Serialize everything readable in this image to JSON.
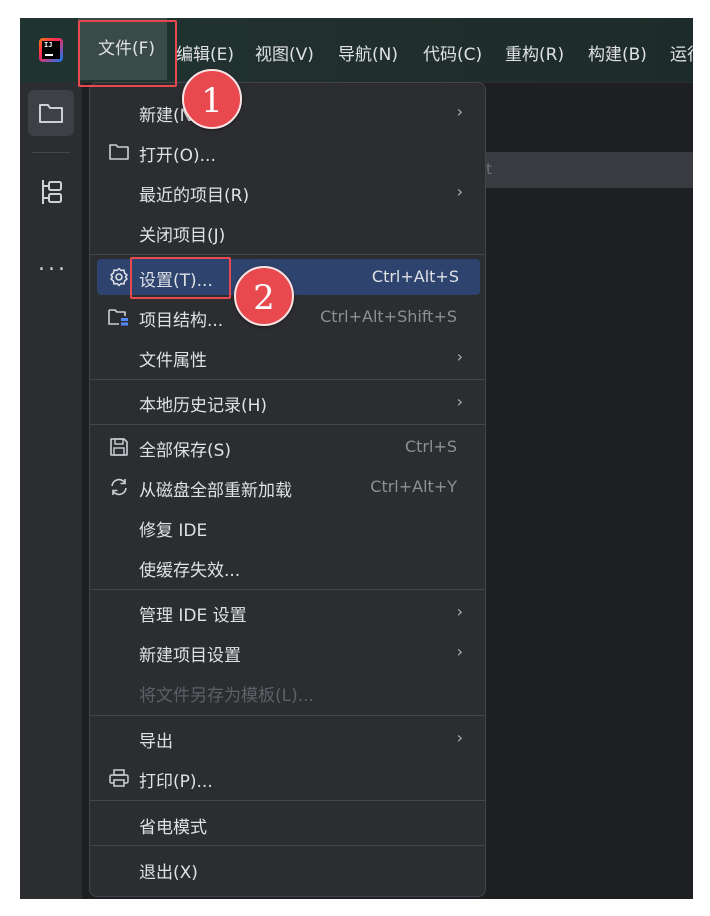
{
  "menubar": {
    "items": [
      {
        "label": "文件(F)"
      },
      {
        "label": "编辑(E)"
      },
      {
        "label": "视图(V)"
      },
      {
        "label": "导航(N)"
      },
      {
        "label": "代码(C)"
      },
      {
        "label": "重构(R)"
      },
      {
        "label": "构建(B)"
      },
      {
        "label": "运行"
      }
    ]
  },
  "logo": {
    "text": "IJ"
  },
  "sidebar": {
    "items": [
      {
        "icon": "folder-icon"
      },
      {
        "icon": "structure-icon"
      },
      {
        "icon": "more-icon",
        "label": "..."
      }
    ]
  },
  "editor": {
    "hint_fragment": "t"
  },
  "file_menu": {
    "items": [
      {
        "label": "新建(N)",
        "submenu": true
      },
      {
        "label": "打开(O)...",
        "icon": "folder-icon"
      },
      {
        "label": "最近的项目(R)",
        "submenu": true
      },
      {
        "label": "关闭项目(J)"
      },
      {
        "label": "设置(T)...",
        "icon": "gear-icon",
        "shortcut": "Ctrl+Alt+S",
        "selected": true
      },
      {
        "label": "项目结构...",
        "icon": "project-structure-icon",
        "shortcut": "Ctrl+Alt+Shift+S"
      },
      {
        "label": "文件属性",
        "submenu": true
      },
      {
        "label": "本地历史记录(H)",
        "submenu": true
      },
      {
        "label": "全部保存(S)",
        "icon": "save-icon",
        "shortcut": "Ctrl+S"
      },
      {
        "label": "从磁盘全部重新加载",
        "icon": "reload-icon",
        "shortcut": "Ctrl+Alt+Y"
      },
      {
        "label": "修复 IDE"
      },
      {
        "label": "使缓存失效..."
      },
      {
        "label": "管理 IDE 设置",
        "submenu": true
      },
      {
        "label": "新建项目设置",
        "submenu": true
      },
      {
        "label": "将文件另存为模板(L)...",
        "disabled": true
      },
      {
        "label": "导出",
        "submenu": true
      },
      {
        "label": "打印(P)...",
        "icon": "print-icon"
      },
      {
        "label": "省电模式"
      },
      {
        "label": "退出(X)"
      }
    ],
    "arrow": "›"
  },
  "callouts": [
    {
      "number": "1"
    },
    {
      "number": "2"
    }
  ],
  "colors": {
    "background": "#1e1f22",
    "menu_bg": "#2b2d30",
    "selection": "#2e436e",
    "callout": "#e7494f"
  }
}
